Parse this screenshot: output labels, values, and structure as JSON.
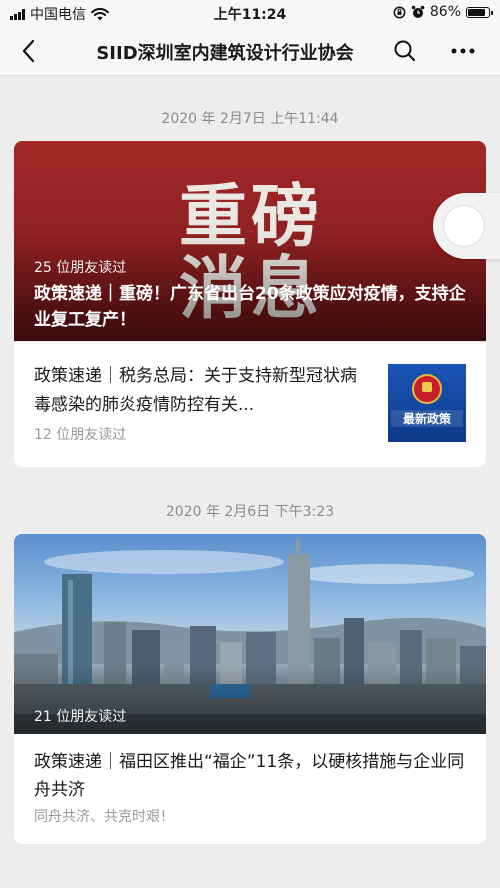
{
  "status_bar": {
    "carrier": "中国电信",
    "time": "上午11:24",
    "battery_percent": "86%",
    "battery_level": 0.86
  },
  "nav": {
    "title": "SIID深圳室内建筑设计行业协会"
  },
  "feed": [
    {
      "timestamp": "2020 年 2月7日 上午11:44",
      "hero": {
        "bg_text_line1": "重磅",
        "bg_text_line2": "消息",
        "reads": "25 位朋友读过",
        "title": "政策速递｜重磅！广东省出台20条政策应对疫情，支持企业复工复产！"
      },
      "sub": {
        "title": "政策速递｜税务总局：关于支持新型冠状病毒感染的肺炎疫情防控有关...",
        "reads": "12 位朋友读过",
        "thumb_label": "最新政策"
      }
    },
    {
      "timestamp": "2020 年 2月6日 下午3:23",
      "hero": {
        "reads": "21 位朋友读过"
      },
      "title": "政策速递｜福田区推出“福企”11条，以硬核措施与企业同舟共济",
      "desc": "同舟共济、共克时艰！"
    }
  ],
  "colors": {
    "background": "#ededed",
    "hero_red": "#8d1f20",
    "thumb_blue": "#1a54b6"
  },
  "icons": [
    "back-arrow-icon",
    "search-icon",
    "more-dots-icon",
    "wifi-icon",
    "signal-icon",
    "alarm-icon",
    "lock-rotation-icon",
    "battery-icon"
  ]
}
